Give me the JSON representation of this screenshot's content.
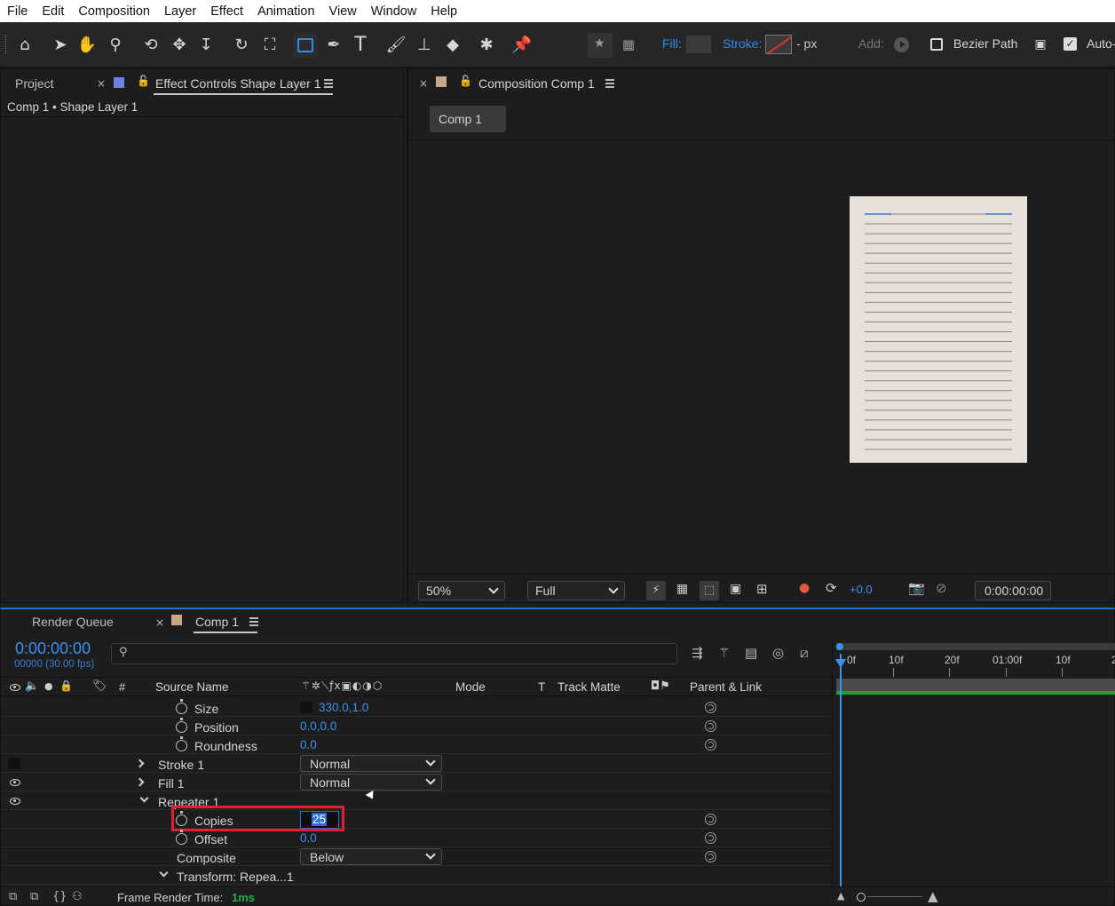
{
  "menu": [
    "File",
    "Edit",
    "Composition",
    "Layer",
    "Effect",
    "Animation",
    "View",
    "Window",
    "Help"
  ],
  "toolbar": {
    "fill_label": "Fill:",
    "stroke_label": "Stroke:",
    "stroke_units": "- px",
    "add_label": "Add:",
    "bezier_label": "Bezier Path",
    "auto_label": "Auto-",
    "colors": {
      "accent": "#2d8ceb",
      "fill_swatch": "#3a3a3a",
      "stroke_slash": "#e03030"
    }
  },
  "project_panel": {
    "tab_project": "Project",
    "tab_effect": "Effect Controls Shape Layer 1",
    "breadcrumb": "Comp 1 • Shape Layer 1",
    "effect_swatch": "#6b82e0"
  },
  "comp_panel": {
    "tab": "Composition Comp 1",
    "comp_button": "Comp 1",
    "comp_swatch": "#c8a88a",
    "zoom": "50%",
    "resolution": "Full",
    "exposure": "+0.0",
    "timecode": "0:00:00:00",
    "canvas_bg": "#e6e0d8",
    "stripe_count": 25
  },
  "timeline": {
    "tab_render": "Render Queue",
    "tab_comp": "Comp 1",
    "time": "0:00:00:00",
    "frames": "00000 (30.00 fps)",
    "search_placeholder": "",
    "headers": {
      "hash": "#",
      "source_name": "Source Name",
      "mode": "Mode",
      "t": "T",
      "track_matte": "Track Matte",
      "parent": "Parent & Link"
    },
    "ruler": [
      "0f",
      "10f",
      "20f",
      "01:00f",
      "10f",
      "2"
    ],
    "rows": {
      "size": {
        "label": "Size",
        "value": "330.0,1.0"
      },
      "position": {
        "label": "Position",
        "value": "0.0,0.0"
      },
      "roundness": {
        "label": "Roundness",
        "value": "0.0"
      },
      "stroke": {
        "label": "Stroke 1",
        "mode": "Normal"
      },
      "fill": {
        "label": "Fill 1",
        "mode": "Normal"
      },
      "repeater": {
        "label": "Repeater 1"
      },
      "copies": {
        "label": "Copies",
        "value": "25"
      },
      "offset": {
        "label": "Offset",
        "value": "0.0"
      },
      "composite": {
        "label": "Composite",
        "value": "Below"
      },
      "transform": {
        "label": "Transform: Repea...1"
      }
    },
    "footer": {
      "label": "Frame Render Time:",
      "value": "1ms"
    }
  }
}
